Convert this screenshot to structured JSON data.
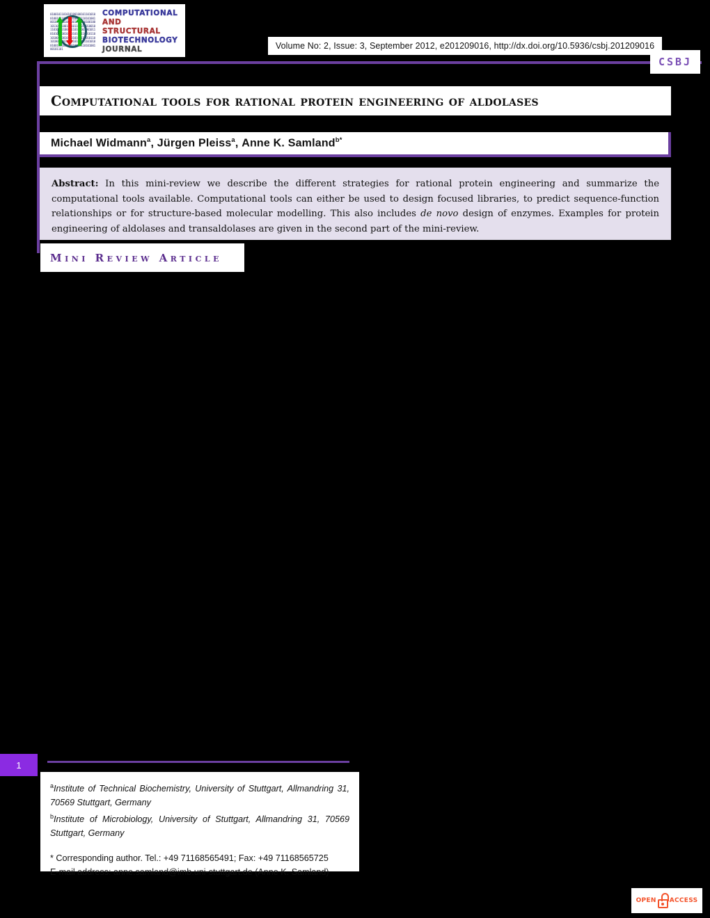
{
  "header": {
    "logo": {
      "line1": "COMPUTATIONAL",
      "line2": "AND STRUCTURAL",
      "line3": "BIOTECHNOLOGY",
      "line4": "JOURNAL",
      "bits": "01001011010101001001011010100100101101010010010110101001001011010100100101101010010010110101001001011010100100101101010010010110101001001011010100100101101010011001011010100110010110101001100101101010011001011010100101101010010010110101001001011010100100101101"
    },
    "volume_line": "Volume No: 2, Issue: 3, September 2012, e201209016, http://dx.doi.org/10.5936/csbj.201209016",
    "badge": "CSBJ"
  },
  "article": {
    "title": "Computational tools for rational protein engineering of aldolases",
    "authors_plain": "Michael Widmann a, Jürgen Pleiss a, Anne K. Samland b*",
    "authors": [
      {
        "name": "Michael Widmann",
        "marks": "a"
      },
      {
        "name": "Jürgen Pleiss",
        "marks": "a"
      },
      {
        "name": "Anne K. Samland",
        "marks": "b*"
      }
    ],
    "abstract_label": "Abstract:",
    "abstract_part1": " In this mini-review we describe the different strategies for rational protein engineering and summarize the computational tools available. Computational tools can either be used to design focused libraries, to predict sequence-function relationships or for structure-based molecular modelling. This also includes ",
    "abstract_italic": "de novo",
    "abstract_part2": " design of enzymes. Examples for protein engineering of aldolases and transaldolases are given in the second part of the mini-review.",
    "article_type": "Mini Review Article"
  },
  "footer": {
    "page_number": "1",
    "affiliation_a_sup": "a",
    "affiliation_a": "Institute of Technical Biochemistry, University of Stuttgart, Allmandring 31, 70569 Stuttgart, Germany",
    "affiliation_b_sup": "b",
    "affiliation_b": "Institute of Microbiology, University of Stuttgart, Allmandring 31, 70569 Stuttgart, Germany",
    "corresponding": "* Corresponding author. Tel.: +49 71168565491; Fax: +49 71168565725",
    "email_label": "E-mail address",
    "email_value": ": anne.samland@imb.uni-stuttgart.de (Anne K. Samland)"
  },
  "open_access": {
    "left_word": "OPEN",
    "right_word": "ACCESS"
  },
  "colors": {
    "accent_purple": "#6b3fa0",
    "badge_purple": "#7a4fb5",
    "page_purple": "#8b2be2",
    "abstract_bg": "#e4dfed",
    "open_access_orange": "#f4522a"
  }
}
